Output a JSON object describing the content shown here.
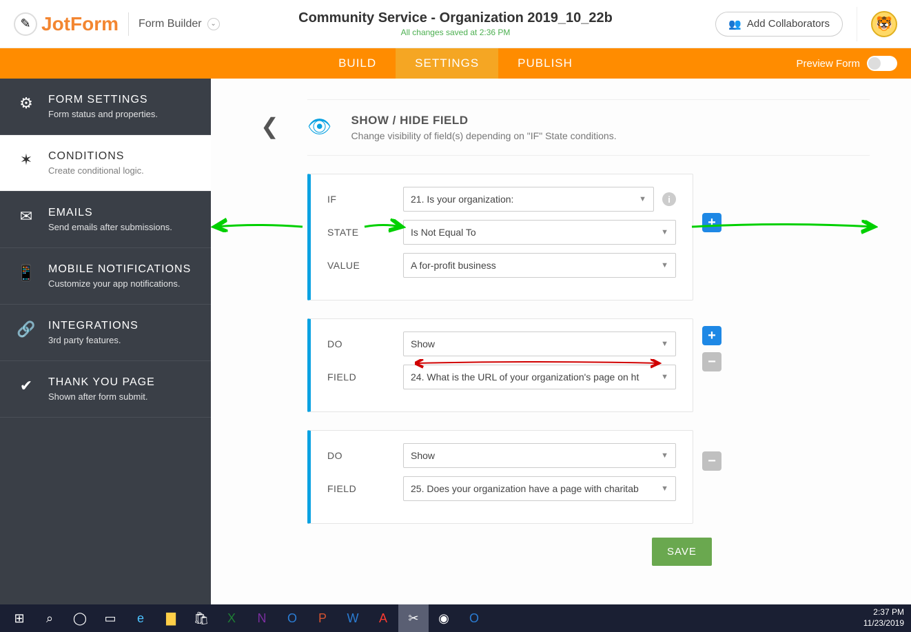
{
  "header": {
    "logo_text": "JotForm",
    "builder_label": "Form Builder",
    "title": "Community Service - Organization 2019_10_22b",
    "saved_status": "All changes saved at 2:36 PM",
    "collab_label": "Add Collaborators"
  },
  "tabs": {
    "build": "BUILD",
    "settings": "SETTINGS",
    "publish": "PUBLISH",
    "preview": "Preview Form"
  },
  "sidebar": {
    "items": [
      {
        "title": "FORM SETTINGS",
        "sub": "Form status and properties."
      },
      {
        "title": "CONDITIONS",
        "sub": "Create conditional logic."
      },
      {
        "title": "EMAILS",
        "sub": "Send emails after submissions."
      },
      {
        "title": "MOBILE NOTIFICATIONS",
        "sub": "Customize your app notifications."
      },
      {
        "title": "INTEGRATIONS",
        "sub": "3rd party features."
      },
      {
        "title": "THANK YOU PAGE",
        "sub": "Shown after form submit."
      }
    ]
  },
  "condition_header": {
    "title": "SHOW / HIDE FIELD",
    "desc": "Change visibility of field(s) depending on \"IF\" State conditions."
  },
  "labels": {
    "if": "IF",
    "state": "STATE",
    "value": "VALUE",
    "do": "DO",
    "field": "FIELD"
  },
  "if_block": {
    "if_value": "21. Is your organization:",
    "state_value": "Is Not Equal To",
    "value_value": "A for-profit business"
  },
  "do_blocks": [
    {
      "do": "Show",
      "field": "24. What is the URL of your organization's page on ht"
    },
    {
      "do": "Show",
      "field": "25. Does your organization have a page with charitab"
    }
  ],
  "save": "SAVE",
  "taskbar": {
    "time": "2:37 PM",
    "date": "11/23/2019"
  }
}
